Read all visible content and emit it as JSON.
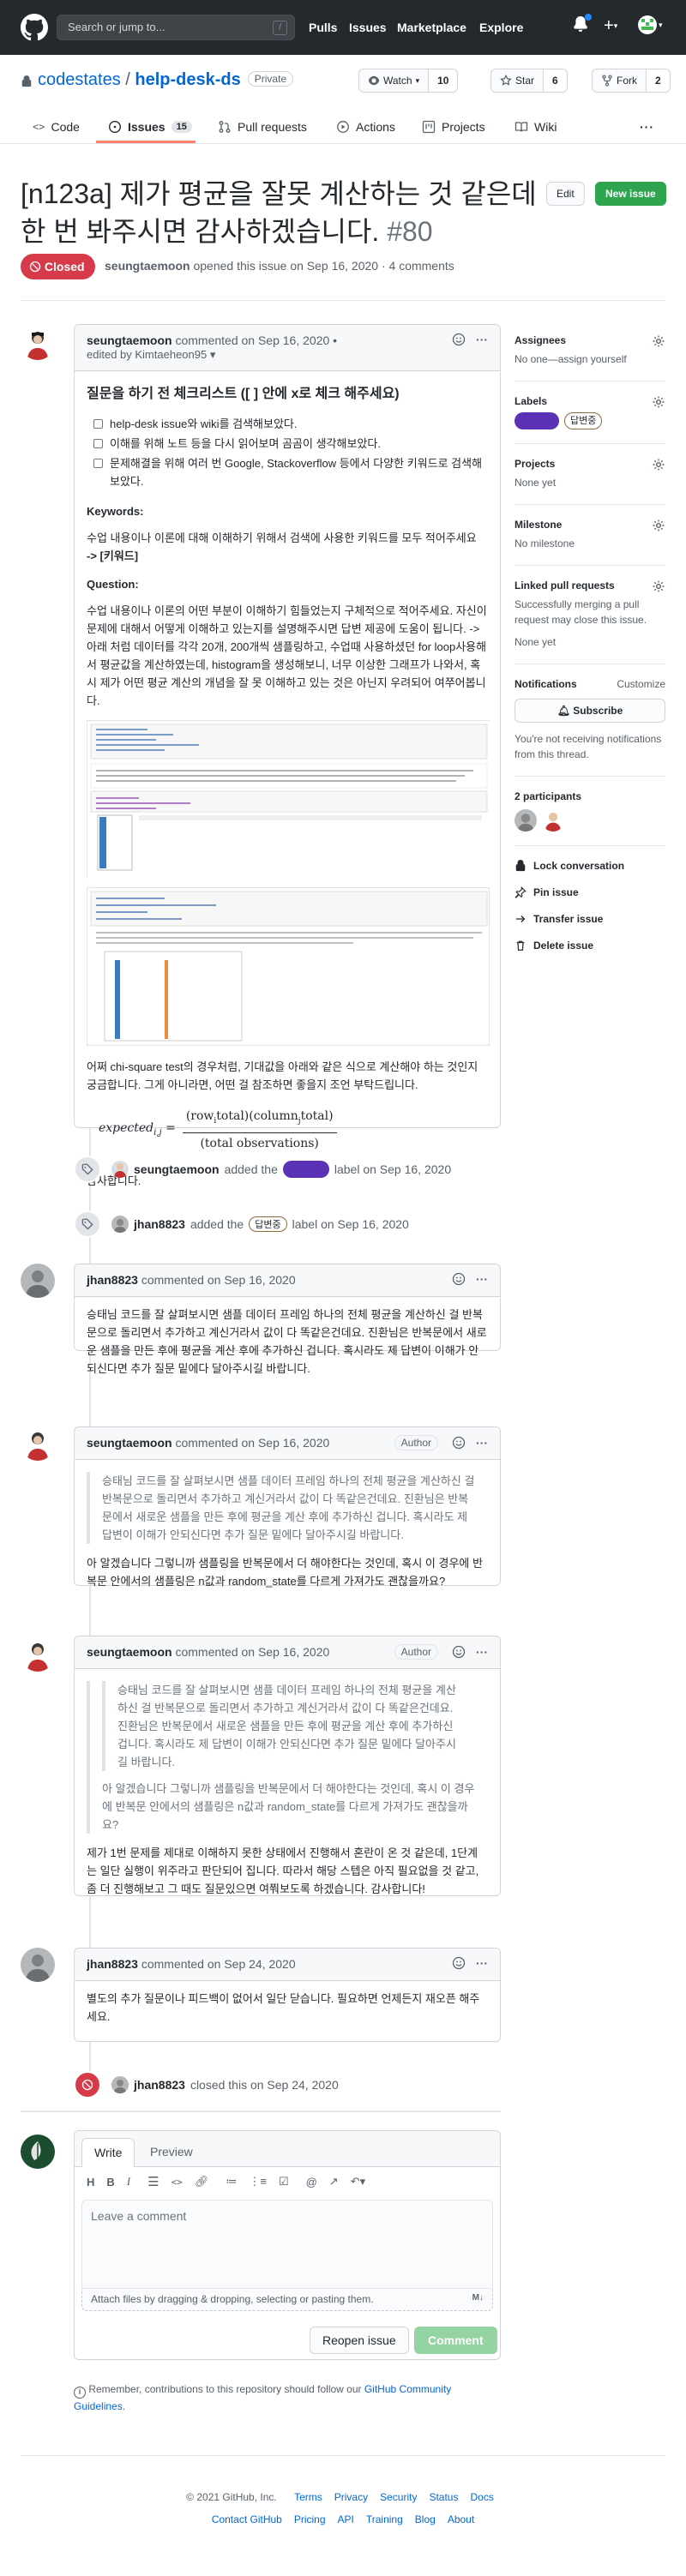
{
  "header": {
    "search_placeholder": "Search or jump to...",
    "slash": "/",
    "nav": [
      "Pulls",
      "Issues",
      "Marketplace",
      "Explore"
    ]
  },
  "repo": {
    "owner": "codestates",
    "sep": " / ",
    "name": "help-desk-ds",
    "visibility": "Private",
    "watch_label": "Watch",
    "watch_count": "10",
    "star_label": "Star",
    "star_count": "6",
    "fork_label": "Fork",
    "fork_count": "2"
  },
  "tabs": {
    "code": "Code",
    "issues": "Issues",
    "issues_count": "15",
    "pulls": "Pull requests",
    "actions": "Actions",
    "projects": "Projects",
    "wiki": "Wiki"
  },
  "issue": {
    "title": "[n123a] 제가 평균을 잘못 계산하는 것 같은데 한 번 봐주시면 감사하겠습니다.",
    "number": "#80",
    "edit": "Edit",
    "new_issue": "New issue",
    "state": "Closed",
    "author": "seungtaemoon",
    "meta_rest": "opened this issue on Sep 16, 2020 · 4 comments"
  },
  "first_comment": {
    "author": "seungtaemoon",
    "when": "commented on Sep 16, 2020 •",
    "edited": "edited by Kimtaeheon95 ▾",
    "checklist_title": "질문을 하기 전 체크리스트 ([ ] 안에 x로 체크 해주세요)",
    "checks": [
      "help-desk issue와 wiki를 검색해보았다.",
      "이해를 위해 노트 등을 다시 읽어보며 곰곰이 생각해보았다.",
      "문제해결을 위해 여러 번 Google, Stackoverflow 등에서 다양한 키워드로 검색해 보았다."
    ],
    "keywords_h": "Keywords:",
    "keywords_p": "수업 내용이나 이론에 대해 이해하기 위해서 검색에 사용한 키워드를 모두 적어주세요",
    "keywords_b": "-> [키워드]",
    "question_h": "Question:",
    "question_p": "수업 내용이나 이론의 어떤 부분이 이해하기 힘들었는지 구체적으로 적어주세요. 자신이 문제에 대해서 어떻게 이해하고 있는지를 설명해주시면 답변 제공에 도움이 됩니다. -> 아래 처럼 데이터를 각각 20개, 200개씩 샘플링하고, 수업때 사용하셨던 for loop사용해서 평균값을 계산하였는데, histogram을 생성해보니, 너무 이상한 그래프가 나와서, 혹시 제가 어떤 평균 계산의 개념을 잘 못 이해하고 있는 것은 아닌지 우려되어 여쭈어봅니다.",
    "chi_p": "어쩌 chi-square test의 경우처럼, 기대값을 아래와 같은 식으로 계산해야 하는 것인지 궁금합니다. 그게 아니라면, 어떤 걸 참조하면 좋을지 조언 부탁드립니다.",
    "formula_lhs": "expected",
    "formula_sub": "i,j",
    "formula_num": "(row",
    "formula_num_i": "i",
    "formula_num_mid": "total)(column",
    "formula_num_j": "j",
    "formula_num_end": "total)",
    "formula_den": "(total observations)",
    "thanks": "감사합니다."
  },
  "events": {
    "e1_user": "seungtaemoon",
    "e1_added": "added the",
    "e1_tail": "label on Sep 16, 2020",
    "e2_user": "jhan8823",
    "e2_added": "added the",
    "e2_label": "답변중",
    "e2_tail": "label on Sep 16, 2020",
    "close_user": "jhan8823",
    "close_tail": "closed this on Sep 24, 2020"
  },
  "comments": [
    {
      "author": "jhan8823",
      "when": "commented on Sep 16, 2020",
      "body": "승태님 코드를 잘 살펴보시면 샘플 데이터 프레임 하나의 전체 평균을 계산하신 걸 반복문으로 돌리면서 추가하고 계신거라서 값이 다 똑같은건데요. 진환님은 반복문에서 새로운 샘플을 만든 후에 평균을 계산 후에 추가하신 겁니다. 혹시라도 제 답변이 이해가 안 되신다면 추가 질문 밑에다 달아주시길 바랍니다."
    },
    {
      "author": "seungtaemoon",
      "when": "commented on Sep 16, 2020",
      "badge": "Author",
      "quote": "승태님 코드를 잘 살펴보시면 샘플 데이터 프레임 하나의 전체 평균을 계산하신 걸 반복문으로 돌리면서 추가하고 계신거라서 값이 다 똑같은건데요. 진환님은 반복문에서 새로운 샘플을 만든 후에 평균을 계산 후에 추가하신 겁니다. 혹시라도 제 답변이 이해가 안되신다면 추가 질문 밑에다 달아주시길 바랍니다.",
      "body": "아 알겠습니다 그렇니까 샘플링을 반복문에서 더 해야한다는 것인데, 혹시 이 경우에 반복문 안에서의 샘플링은 n값과 random_state를 다르게 가져가도 괜찮을까요?"
    },
    {
      "author": "seungtaemoon",
      "when": "commented on Sep 16, 2020",
      "badge": "Author",
      "quote1": "승태님 코드를 잘 살펴보시면 샘플 데이터 프레임 하나의 전체 평균을 계산하신 걸 반복문으로 돌리면서 추가하고 계신거라서 값이 다 똑같은건데요. 진환님은 반복문에서 새로운 샘플을 만든 후에 평균을 계산 후에 추가하신 겁니다. 혹시라도 제 답변이 이해가 안되신다면 추가 질문 밑에다 달아주시길 바랍니다.",
      "quote2": "아 알겠습니다 그렇니까 샘플링을 반복문에서 더 해야한다는 것인데, 혹시 이 경우에 반복문 안에서의 샘플링은 n값과 random_state를 다르게 가져가도 괜찮을까요?",
      "body": "제가 1번 문제를 제대로 이해하지 못한 상태에서 진행해서 혼란이 온 것 같은데, 1단계는 일단 실행이 위주라고 판단되어 집니다. 따라서 해당 스텝은 아직 필요없을 것 같고, 좀 더 진행해보고 그 때도 질문있으면 여쭤보도록 하겠습니다. 감사합니다!"
    },
    {
      "author": "jhan8823",
      "when": "commented on Sep 24, 2020",
      "body": "별도의 추가 질문이나 피드백이 없어서 일단 닫습니다. 필요하면 언제든지 재오픈 해주세요."
    }
  ],
  "sidebar": {
    "assignees": "Assignees",
    "assignees_none": "No one—assign yourself",
    "labels": "Labels",
    "label2": "답변중",
    "projects": "Projects",
    "projects_none": "None yet",
    "milestone": "Milestone",
    "milestone_none": "No milestone",
    "linked": "Linked pull requests",
    "linked_desc": "Successfully merging a pull request may close this issue.",
    "linked_none": "None yet",
    "notifications": "Notifications",
    "customize": "Customize",
    "subscribe": "Subscribe",
    "notif_desc": "You're not receiving notifications from this thread.",
    "participants": "2 participants",
    "lock": "Lock conversation",
    "pin": "Pin issue",
    "transfer": "Transfer issue",
    "delete": "Delete issue"
  },
  "editor": {
    "write": "Write",
    "preview": "Preview",
    "placeholder": "Leave a comment",
    "attach": "Attach files by dragging & dropping, selecting or pasting them.",
    "reopen": "Reopen issue",
    "comment": "Comment"
  },
  "remember": {
    "text": "Remember, contributions to this repository should follow our",
    "link": "GitHub Community Guidelines",
    "end": "."
  },
  "footer": {
    "copyright": "© 2021 GitHub, Inc.",
    "row1": [
      "Terms",
      "Privacy",
      "Security",
      "Status",
      "Docs"
    ],
    "row2": [
      "Contact GitHub",
      "Pricing",
      "API",
      "Training",
      "Blog",
      "About"
    ]
  },
  "colors": {
    "closed": "#d73a49",
    "new_issue": "#2ea44f",
    "label_purple": "#5b31b6",
    "link": "#0366d6"
  }
}
